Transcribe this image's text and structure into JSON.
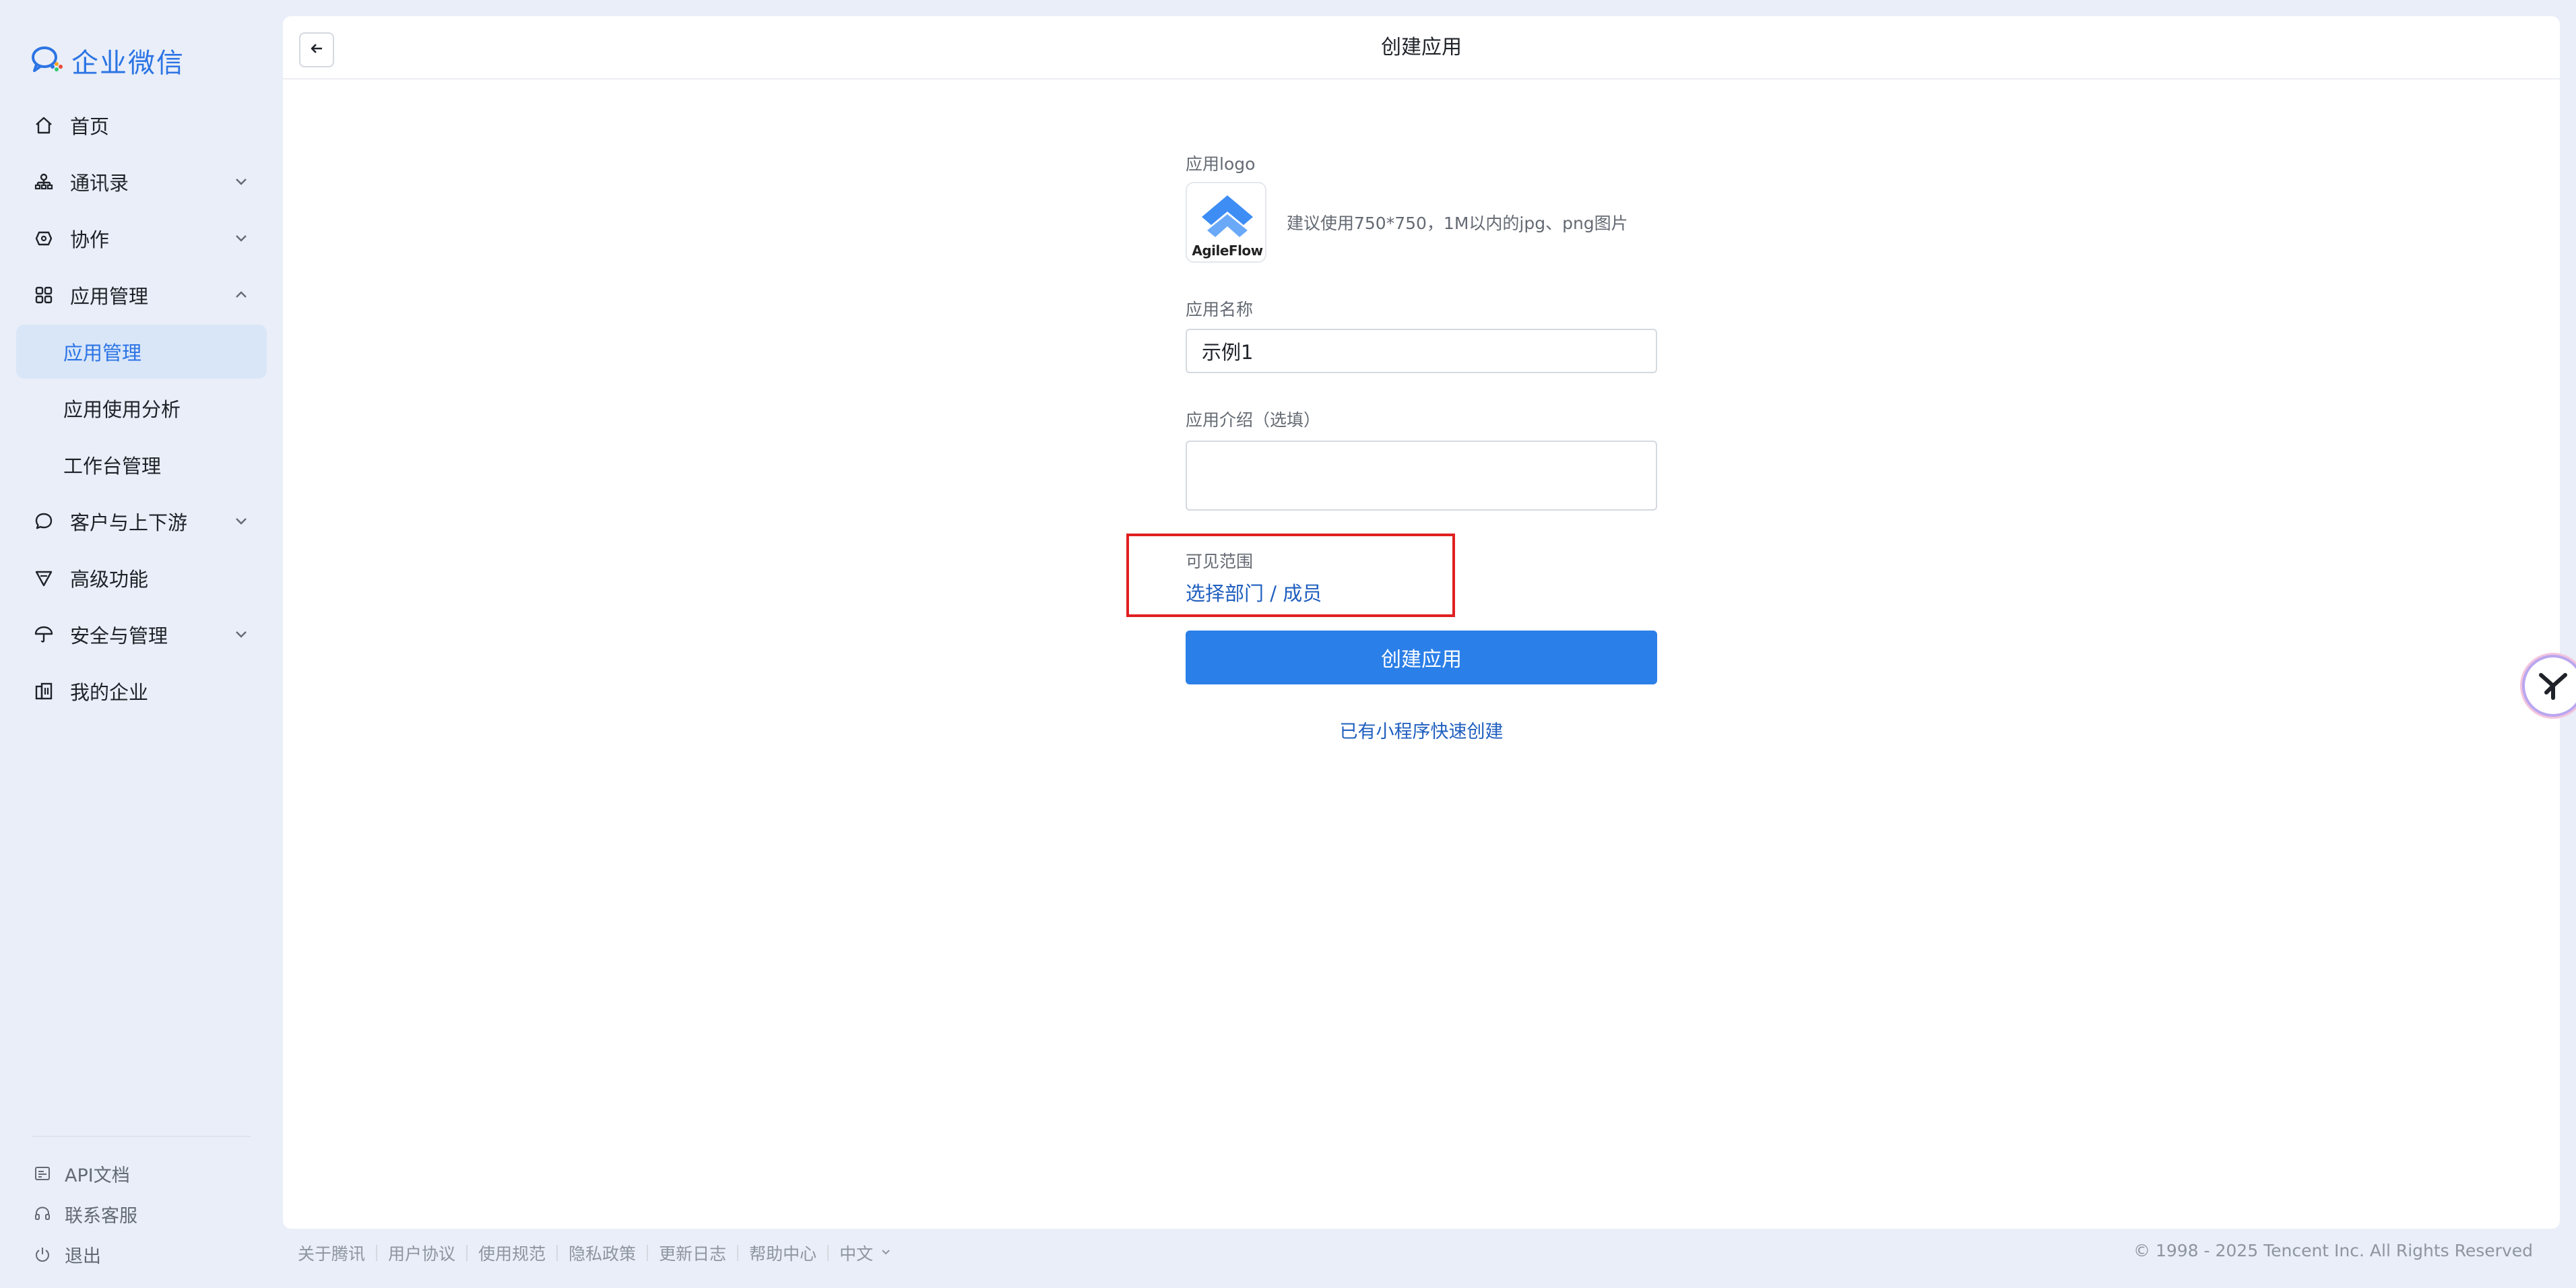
{
  "brand": {
    "name": "企业微信"
  },
  "sidebar": {
    "items": [
      {
        "label": "首页",
        "icon": "home-icon"
      },
      {
        "label": "通讯录",
        "icon": "org-chart-icon"
      },
      {
        "label": "协作",
        "icon": "collaboration-icon"
      },
      {
        "label": "应用管理",
        "icon": "grid-icon"
      },
      {
        "label": "应用管理",
        "active": true
      },
      {
        "label": "应用使用分析"
      },
      {
        "label": "工作台管理"
      },
      {
        "label": "客户与上下游",
        "icon": "chat-icon"
      },
      {
        "label": "高级功能",
        "icon": "triangle-icon"
      },
      {
        "label": "安全与管理",
        "icon": "umbrella-icon"
      },
      {
        "label": "我的企业",
        "icon": "building-icon"
      }
    ],
    "bottom": [
      {
        "label": "API文档",
        "icon": "api-doc-icon"
      },
      {
        "label": "联系客服",
        "icon": "headset-icon"
      },
      {
        "label": "退出",
        "icon": "power-icon"
      }
    ]
  },
  "page": {
    "title": "创建应用"
  },
  "form": {
    "logo_label": "应用logo",
    "logo_caption": "AgileFlow",
    "logo_hint": "建议使用750*750，1M以内的jpg、png图片",
    "name_label": "应用名称",
    "name_value": "示例1",
    "intro_label": "应用介绍（选填）",
    "intro_value": "",
    "scope_label": "可见范围",
    "scope_link": "选择部门 / 成员",
    "submit_label": "创建应用",
    "mini_program_link": "已有小程序快速创建"
  },
  "footer": {
    "links": [
      "关于腾讯",
      "用户协议",
      "使用规范",
      "隐私政策",
      "更新日志",
      "帮助中心"
    ],
    "language": "中文",
    "copyright": "© 1998 - 2025 Tencent Inc. All Rights Reserved"
  },
  "colors": {
    "accent": "#2b7fe8",
    "brand": "#2b74e4",
    "link": "#1f5fbf",
    "highlight": "#e02020",
    "background": "#e9eef8"
  }
}
